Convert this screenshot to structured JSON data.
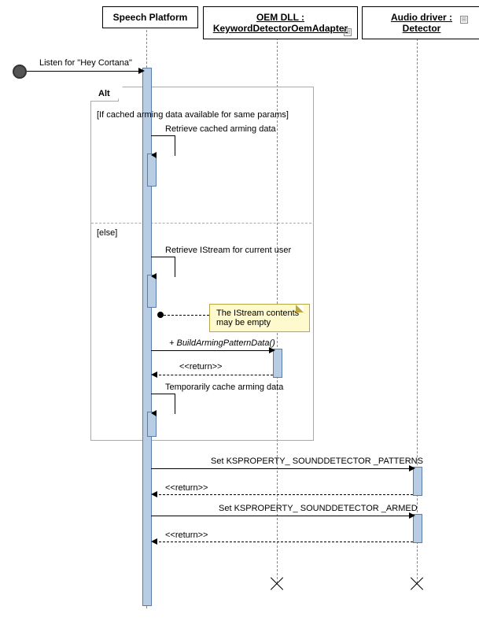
{
  "participants": {
    "p1": "Speech Platform",
    "p2": "OEM DLL :\nKeywordDetectorOemAdapter",
    "p3": "Audio driver : Detector"
  },
  "initial_message": "Listen for \"Hey Cortana\"",
  "alt": {
    "label": "Alt",
    "guard1": "[If cached arming data available for same params]",
    "msg1": "Retrieve cached arming data",
    "guard2": "[else]",
    "msg2": "Retrieve IStream for current user",
    "note": "The IStream contents may be empty",
    "msg3": "+ BuildArmingPatternData()",
    "ret1": "<<return>>",
    "msg4": "Temporarily cache arming data"
  },
  "final": {
    "msg1": "Set KSPROPERTY_ SOUNDDETECTOR _PATTERNS",
    "ret1": "<<return>>",
    "msg2": "Set KSPROPERTY_ SOUNDDETECTOR _ARMED",
    "ret2": "<<return>>"
  }
}
